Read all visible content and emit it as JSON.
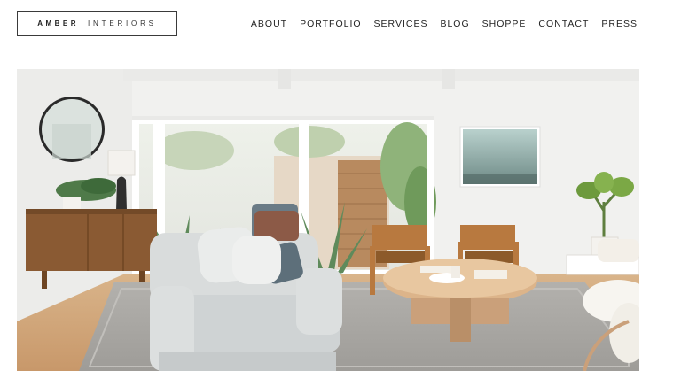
{
  "brand": {
    "word1": "AMBER",
    "word2": "INTERIORS"
  },
  "nav": {
    "items": [
      {
        "label": "ABOUT"
      },
      {
        "label": "PORTFOLIO"
      },
      {
        "label": "SERVICES"
      },
      {
        "label": "BLOG"
      },
      {
        "label": "SHOPPE"
      },
      {
        "label": "CONTACT"
      },
      {
        "label": "PRESS"
      }
    ]
  },
  "hero": {
    "subject": "living-room-photo"
  }
}
